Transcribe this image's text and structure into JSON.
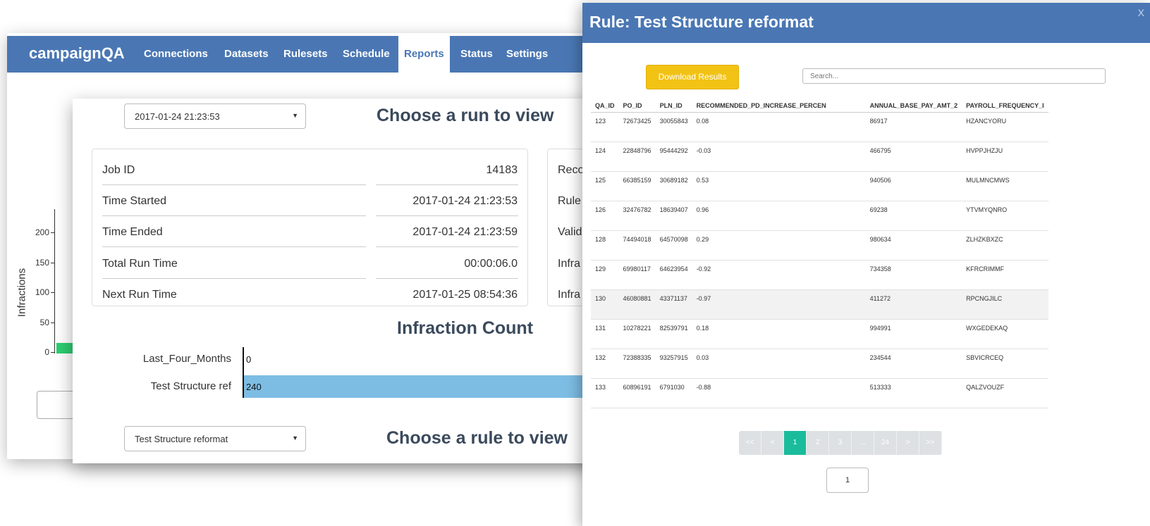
{
  "app": {
    "brand": "campaignQA",
    "nav": [
      "Connections",
      "Datasets",
      "Rulesets",
      "Schedule",
      "Reports",
      "Status",
      "Settings"
    ],
    "active_nav": "Reports"
  },
  "background_chart": {
    "ylabel": "Infractions",
    "yticks": [
      "200",
      "150",
      "100",
      "50",
      "0"
    ],
    "bar_color": "#2ecc71"
  },
  "report": {
    "run_select": "2017-01-24 21:23:53",
    "run_heading": "Choose a run to view",
    "info": [
      {
        "label": "Job ID",
        "value": "14183"
      },
      {
        "label": "Time Started",
        "value": "2017-01-24 21:23:53"
      },
      {
        "label": "Time Ended",
        "value": "2017-01-24 21:23:59"
      },
      {
        "label": "Total Run Time",
        "value": "00:00:06.0"
      },
      {
        "label": "Next Run Time",
        "value": "2017-01-25 08:54:36"
      }
    ],
    "side_labels": [
      "Reco",
      "Rule",
      "Valid",
      "Infra",
      "Infra"
    ],
    "infraction_heading": "Infraction Count",
    "rule_select": "Test Structure reformat",
    "rule_heading": "Choose a rule to view"
  },
  "chart_data": {
    "type": "bar",
    "orientation": "horizontal",
    "title": "Infraction Count",
    "categories": [
      "Last_Four_Months",
      "Test Structure ref"
    ],
    "values": [
      0,
      240
    ],
    "data_labels": [
      "0",
      "240"
    ],
    "bar_color": "#7dbde4"
  },
  "modal": {
    "title": "Rule: Test Structure reformat",
    "close": "X",
    "download_label": "Download Results",
    "search_placeholder": "Search...",
    "columns": [
      "QA_ID",
      "PO_ID",
      "PLN_ID",
      "RECOMMENDED_PD_INCREASE_PERCEN",
      "ANNUAL_BASE_PAY_AMT_2",
      "PAYROLL_FREQUENCY_I"
    ],
    "rows": [
      [
        "123",
        "72673425",
        "30055843",
        "0.08",
        "86917",
        "HZANCYORU"
      ],
      [
        "124",
        "22848796",
        "95444292",
        "-0.03",
        "466795",
        "HVPPJHZJU"
      ],
      [
        "125",
        "66385159",
        "30689182",
        "0.53",
        "940506",
        "MULMNCMWS"
      ],
      [
        "126",
        "32476782",
        "18639407",
        "0.96",
        "69238",
        "YTVMYQNRO"
      ],
      [
        "128",
        "74494018",
        "64570098",
        "0.29",
        "980634",
        "ZLHZKBXZC"
      ],
      [
        "129",
        "69980117",
        "64623954",
        "-0.92",
        "734358",
        "KFRCRIMMF"
      ],
      [
        "130",
        "46080881",
        "43371137",
        "-0.97",
        "411272",
        "RPCNGJILC"
      ],
      [
        "131",
        "10278221",
        "82539791",
        "0.18",
        "994991",
        "WXGEDEKAQ"
      ],
      [
        "132",
        "72388335",
        "93257915",
        "0.03",
        "234544",
        "SBVICRCEQ"
      ],
      [
        "133",
        "60896191",
        "6791030",
        "-0.88",
        "513333",
        "QALZVOUZF"
      ]
    ],
    "highlight_row": 6,
    "pagination": [
      "<<",
      "<",
      "1",
      "2",
      "3",
      "...",
      "24",
      ">",
      ">>"
    ],
    "active_page": "1",
    "page_input": "1"
  },
  "colors": {
    "navbar": "#4a77b4",
    "download": "#f2c215",
    "active_page": "#1abc9c",
    "bar": "#7dbde4",
    "green_bar": "#2ecc71"
  }
}
